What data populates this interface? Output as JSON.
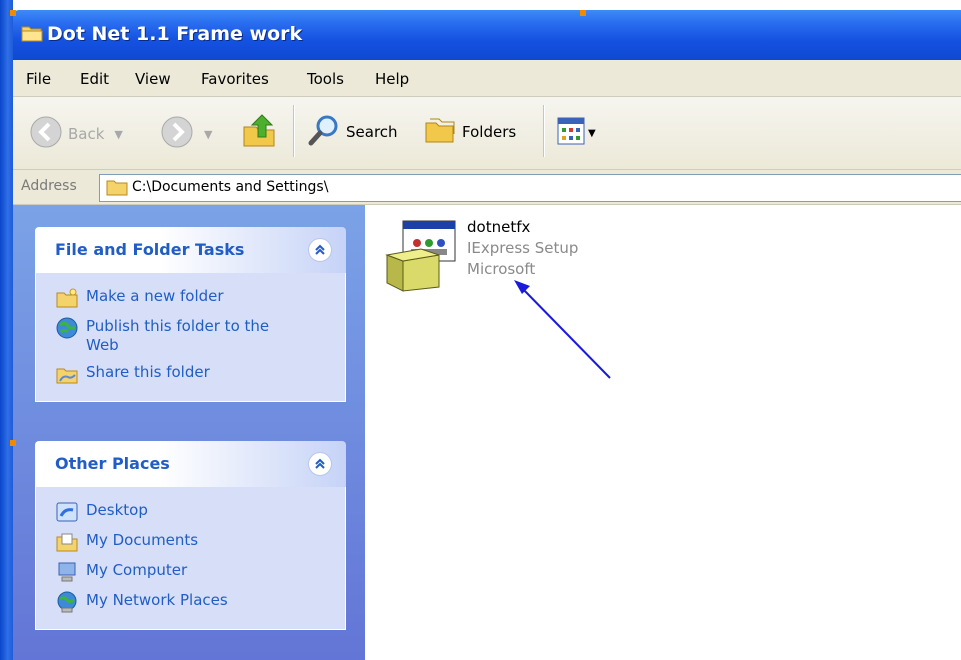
{
  "window": {
    "title": "Dot Net 1.1 Frame work"
  },
  "menu": [
    "File",
    "Edit",
    "View",
    "Favorites",
    "Tools",
    "Help"
  ],
  "toolbar": {
    "back_label": "Back",
    "search_label": "Search",
    "folders_label": "Folders"
  },
  "address": {
    "label": "Address",
    "value": "C:\\Documents and Settings\\"
  },
  "tasks": {
    "title": "File and Folder Tasks",
    "items": [
      "Make a new folder",
      "Publish this folder to the Web",
      "Share this folder"
    ]
  },
  "places": {
    "title": "Other Places",
    "items": [
      "Desktop",
      "My Documents",
      "My Computer",
      "My Network Places"
    ]
  },
  "file": {
    "name": "dotnetfx",
    "description": "IExpress Setup",
    "company": "Microsoft"
  },
  "colors": {
    "title_blue": "#0f49d3",
    "task_link": "#215dc6",
    "annotation_arrow": "#1a1adc"
  }
}
